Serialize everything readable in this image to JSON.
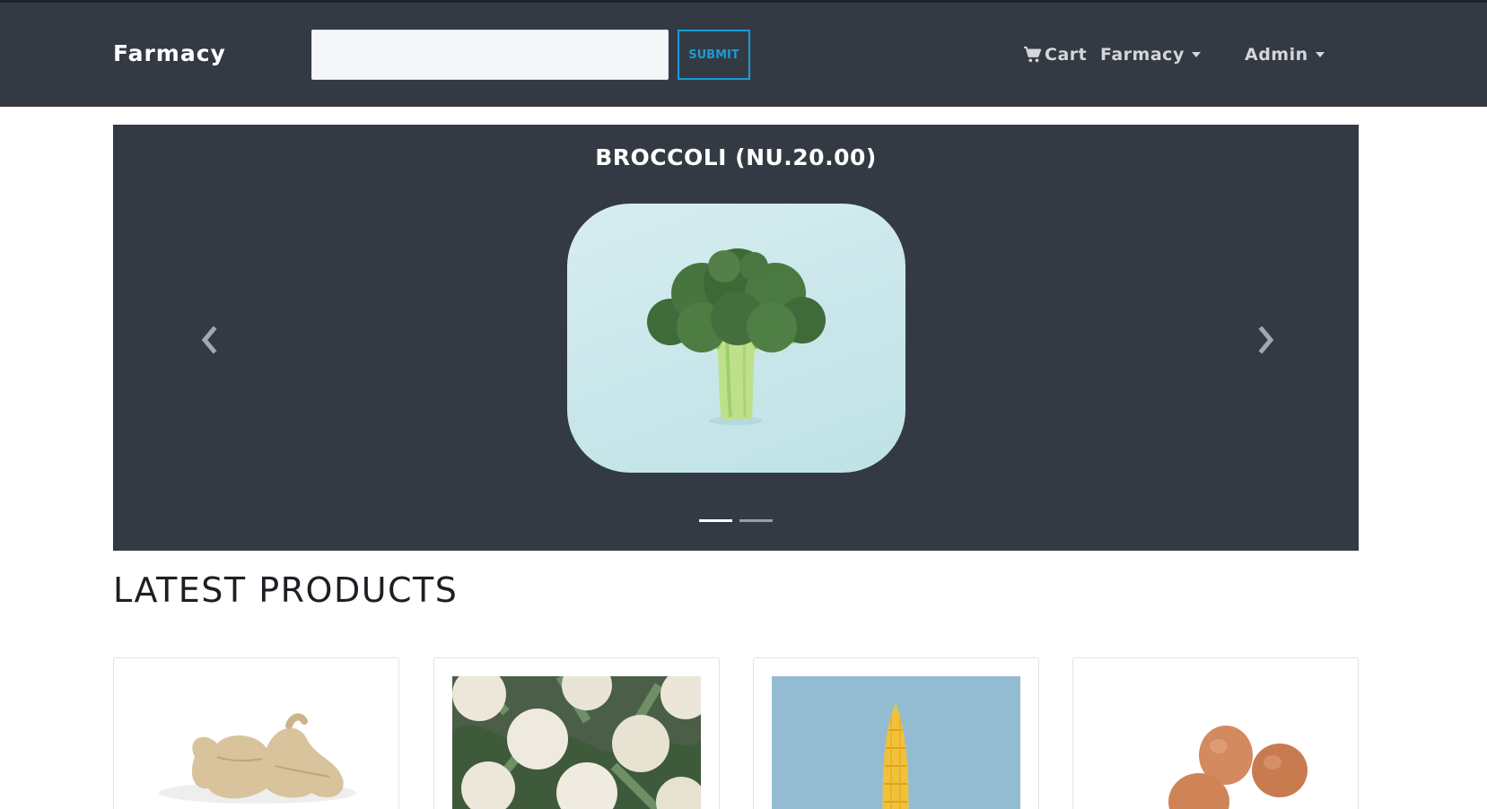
{
  "navbar": {
    "brand": "Farmacy",
    "search": {
      "value": "",
      "placeholder": ""
    },
    "submit_label": "SUBMIT",
    "cart_label": "Cart",
    "farmacy_menu_label": "Farmacy",
    "admin_menu_label": "Admin"
  },
  "carousel": {
    "slide_title": "BROCCOLI (NU.20.00)",
    "slide_count": 2,
    "active_index": 0
  },
  "section": {
    "title": "LATEST PRODUCTS"
  },
  "products": [
    {
      "image": "ginger"
    },
    {
      "image": "cauliflower"
    },
    {
      "image": "corn"
    },
    {
      "image": "eggs"
    }
  ],
  "colors": {
    "navbar_bg": "#343a43",
    "accent": "#1a9bd7",
    "carousel_bg": "#343a43"
  }
}
